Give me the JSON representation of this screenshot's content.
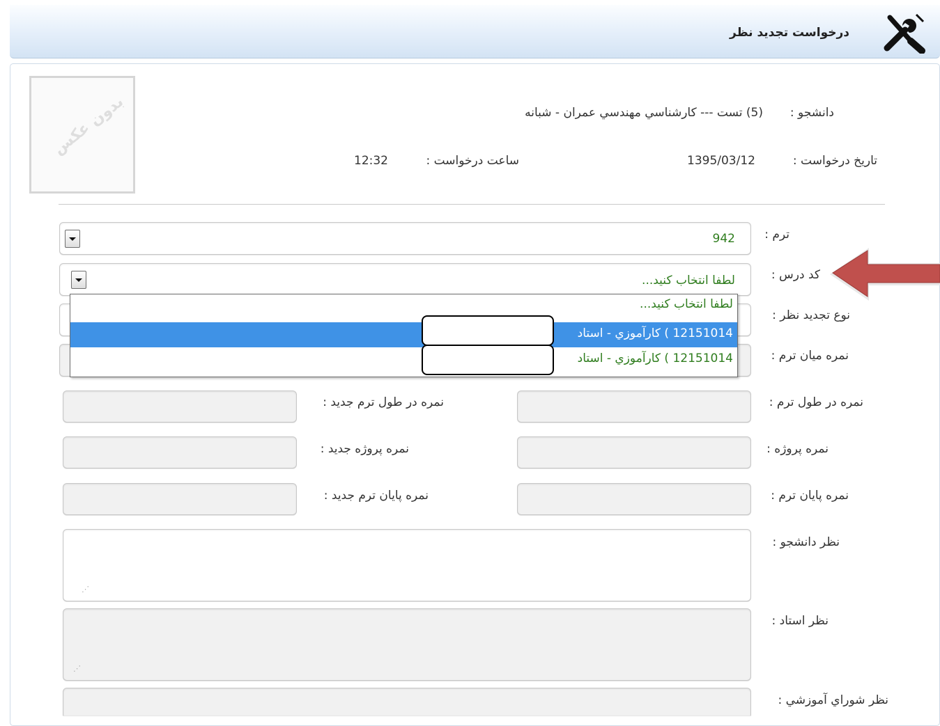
{
  "header": {
    "title": "درخواست تجدید نظر",
    "icon": "tools-icon"
  },
  "photo": {
    "placeholder_text": "بدون عکس"
  },
  "student": {
    "label": "دانشجو :",
    "value": "(5) تست --- کارشناسي مهندسي عمران - شبانه"
  },
  "request_date": {
    "label": "تاریخ درخواست :",
    "value": "1395/03/12"
  },
  "request_time": {
    "label": "ساعت درخواست :",
    "value": "12:32"
  },
  "form": {
    "term": {
      "label": "ترم :",
      "value": "942"
    },
    "course_code": {
      "label": "کد درس :",
      "value": "لطفا انتخاب کنید...",
      "options": [
        "لطفا انتخاب کنید...",
        "12151014 ) کارآموزي - استاد",
        "12151014 ) کارآموزي - استاد"
      ],
      "highlighted_option": "12151014 ) کارآموزي - استاد"
    },
    "review_type": {
      "label": "نوع تجدید نظر :"
    },
    "midterm_grade": {
      "label": "نمره میان ترم :"
    },
    "during_term_grade": {
      "label": "نمره در طول ترم :"
    },
    "new_during_term_grade": {
      "label": "نمره در طول ترم جدید :"
    },
    "project_grade": {
      "label": "نمره پروژه :"
    },
    "new_project_grade": {
      "label": "نمره پروژه جدید :"
    },
    "final_grade": {
      "label": "نمره پایان ترم :"
    },
    "new_final_grade": {
      "label": "نمره پایان ترم جدید :"
    },
    "student_opinion": {
      "label": "نظر دانشجو :"
    },
    "professor_opinion": {
      "label": "نظر استاد :"
    },
    "council_opinion": {
      "label": "نظر شوراي آموزشي :"
    }
  },
  "colors": {
    "selected_option": "#3f92e6",
    "combo_text": "#2f7d1e",
    "arrow": "#c0504d"
  }
}
